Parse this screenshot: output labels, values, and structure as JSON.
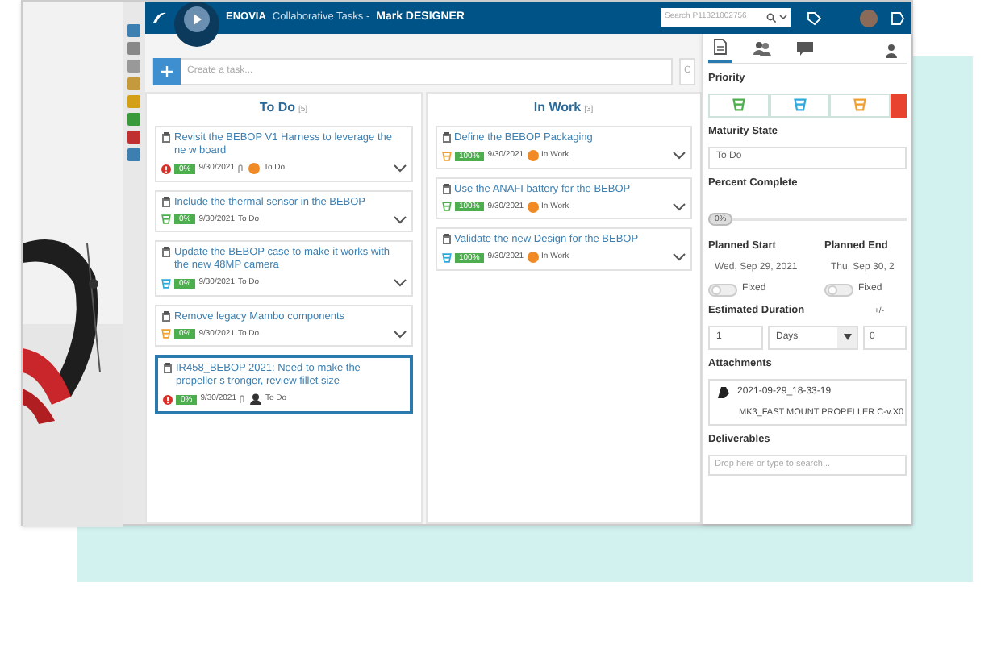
{
  "header": {
    "brand": "ENOVIA",
    "app": "Collaborative Tasks -",
    "user": "Mark DESIGNER",
    "search_placeholder": "Search P11321002756"
  },
  "create_task": {
    "placeholder": "Create a task...",
    "side_field": "C"
  },
  "columns": [
    {
      "title": "To Do",
      "count": "[5]",
      "tasks": [
        {
          "title": "Revisit the BEBOP V1 Harness to leverage the ne w board",
          "kind": "urgent",
          "percent": "0%",
          "date": "9/30/2021",
          "attachment": true,
          "avatar": true,
          "photo": false,
          "status": "To Do",
          "selected": false,
          "expandable": true
        },
        {
          "title": "Include the thermal sensor in the BEBOP",
          "kind": "low",
          "percent": "0%",
          "date": "9/30/2021",
          "attachment": false,
          "avatar": false,
          "photo": false,
          "status": "To Do",
          "selected": false,
          "expandable": true
        },
        {
          "title": "Update the BEBOP case to make it works with the new 48MP camera",
          "kind": "medium",
          "percent": "0%",
          "date": "9/30/2021",
          "attachment": false,
          "avatar": false,
          "photo": false,
          "status": "To Do",
          "selected": false,
          "expandable": true
        },
        {
          "title": "Remove legacy Mambo components",
          "kind": "high",
          "percent": "0%",
          "date": "9/30/2021",
          "attachment": false,
          "avatar": false,
          "photo": false,
          "status": "To Do",
          "selected": false,
          "expandable": true
        },
        {
          "title": "IR458_BEBOP 2021: Need to make the propeller s tronger, review fillet size",
          "kind": "urgent",
          "percent": "0%",
          "date": "9/30/2021",
          "attachment": true,
          "avatar": false,
          "photo": true,
          "status": "To Do",
          "selected": true,
          "expandable": false
        }
      ]
    },
    {
      "title": "In Work",
      "count": "[3]",
      "tasks": [
        {
          "title": "Define the BEBOP Packaging",
          "kind": "high",
          "percent": "100%",
          "date": "9/30/2021",
          "attachment": false,
          "avatar": true,
          "photo": false,
          "status": "In Work",
          "selected": false,
          "expandable": true
        },
        {
          "title": "Use the ANAFI battery for the BEBOP",
          "kind": "low",
          "percent": "100%",
          "date": "9/30/2021",
          "attachment": false,
          "avatar": true,
          "photo": false,
          "status": "In Work",
          "selected": false,
          "expandable": true
        },
        {
          "title": "Validate the new Design for the BEBOP",
          "kind": "medium",
          "percent": "100%",
          "date": "9/30/2021",
          "attachment": false,
          "avatar": true,
          "photo": false,
          "status": "In Work",
          "selected": false,
          "expandable": true
        }
      ]
    }
  ],
  "panel": {
    "tabs": [
      {
        "kind": "document",
        "selected": true
      },
      {
        "kind": "people",
        "selected": false
      },
      {
        "kind": "chat",
        "selected": false
      }
    ],
    "priority_label": "Priority",
    "priorities": [
      {
        "kind": "low",
        "selected": false
      },
      {
        "kind": "medium",
        "selected": false
      },
      {
        "kind": "high",
        "selected": false
      },
      {
        "kind": "urgent",
        "selected": true
      }
    ],
    "maturity_label": "Maturity State",
    "maturity": "To Do",
    "percent_label": "Percent Complete",
    "percent": {
      "reading": "0%",
      "level": 0
    },
    "start_label": "Planned Start",
    "start": "Wed, Sep 29, 2021",
    "start_fixed": {
      "label": "Fixed",
      "on": false
    },
    "end_label": "Planned End",
    "end": "Thu, Sep 30, 2",
    "end_fixed": {
      "label": "Fixed",
      "on": false
    },
    "duration_label": "Estimated Duration",
    "duration": "1",
    "unit": "Days",
    "tolerance_label": "+/-",
    "tolerance": "0",
    "attachments_label": "Attachments",
    "attachment_name": "2021-09-29_18-33-19",
    "attachment_file": "MK3_FAST MOUNT PROPELLER C-v.X0",
    "deliverables_label": "Deliverables",
    "deliverables_placeholder": "Drop here or type to search..."
  }
}
